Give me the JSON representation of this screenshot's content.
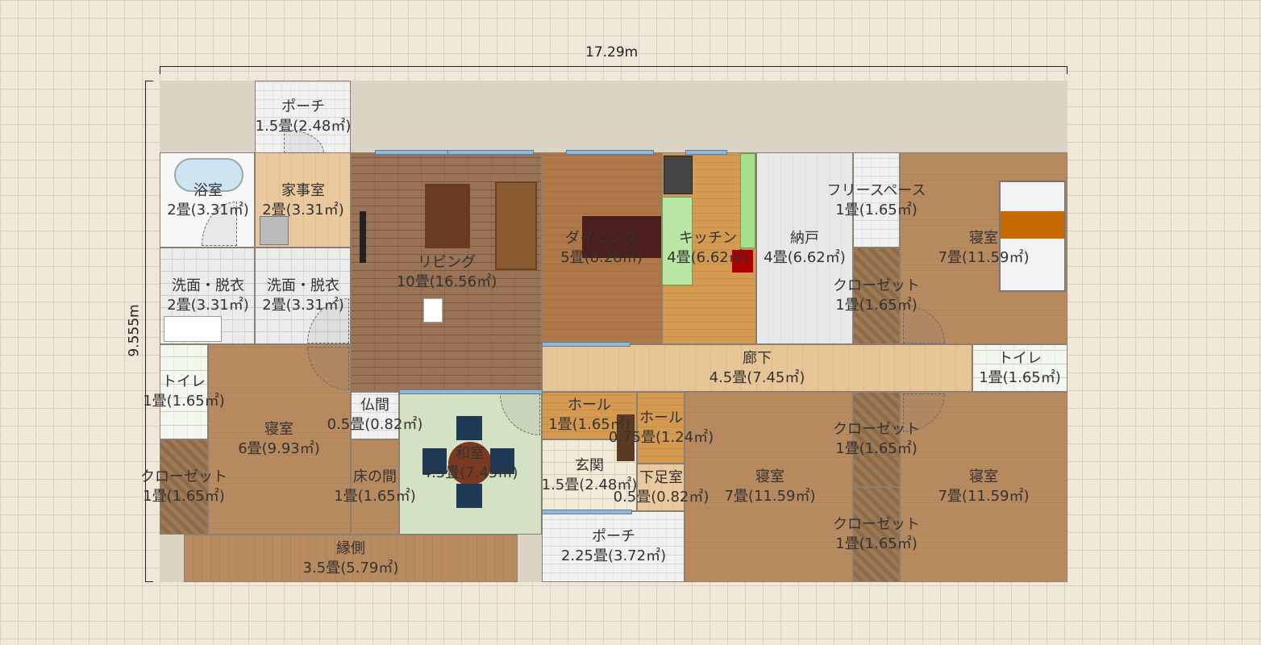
{
  "dimensions": {
    "width_label": "17.29m",
    "height_label": "9.555m"
  },
  "rooms": [
    {
      "name": "ポーチ",
      "area": "1.5畳(2.48㎡)"
    },
    {
      "name": "浴室",
      "area": "2畳(3.31㎡)"
    },
    {
      "name": "家事室",
      "area": "2畳(3.31㎡)"
    },
    {
      "name": "洗面・脱衣",
      "area": "2畳(3.31㎡)"
    },
    {
      "name": "洗面・脱衣",
      "area": "2畳(3.31㎡)"
    },
    {
      "name": "リビング",
      "area": "10畳(16.56㎡)"
    },
    {
      "name": "ダイニング",
      "area": "5畳(8.28㎡)"
    },
    {
      "name": "キッチン",
      "area": "4畳(6.62㎡)"
    },
    {
      "name": "納戸",
      "area": "4畳(6.62㎡)"
    },
    {
      "name": "フリースペース",
      "area": "1畳(1.65㎡)"
    },
    {
      "name": "寝室",
      "area": "7畳(11.59㎡)"
    },
    {
      "name": "クローゼット",
      "area": "1畳(1.65㎡)"
    },
    {
      "name": "廊下",
      "area": "4.5畳(7.45㎡)"
    },
    {
      "name": "トイレ",
      "area": "1畳(1.65㎡)"
    },
    {
      "name": "トイレ",
      "area": "1畳(1.65㎡)"
    },
    {
      "name": "寝室",
      "area": "6畳(9.93㎡)"
    },
    {
      "name": "仏間",
      "area": "0.5畳(0.82㎡)"
    },
    {
      "name": "和室",
      "area": "4.5畳(7.45㎡)"
    },
    {
      "name": "ホール",
      "area": "1畳(1.65㎡)"
    },
    {
      "name": "ホール",
      "area": "0.75畳(1.24㎡)"
    },
    {
      "name": "クローゼット",
      "area": "1畳(1.65㎡)"
    },
    {
      "name": "クローゼット",
      "area": "1畳(1.65㎡)"
    },
    {
      "name": "床の間",
      "area": "1畳(1.65㎡)"
    },
    {
      "name": "玄関",
      "area": "1.5畳(2.48㎡)"
    },
    {
      "name": "下足室",
      "area": "0.5畳(0.82㎡)"
    },
    {
      "name": "寝室",
      "area": "7畳(11.59㎡)"
    },
    {
      "name": "寝室",
      "area": "7畳(11.59㎡)"
    },
    {
      "name": "クローゼット",
      "area": "1畳(1.65㎡)"
    },
    {
      "name": "縁側",
      "area": "3.5畳(5.79㎡)"
    },
    {
      "name": "ポーチ",
      "area": "2.25畳(3.72㎡)"
    }
  ]
}
